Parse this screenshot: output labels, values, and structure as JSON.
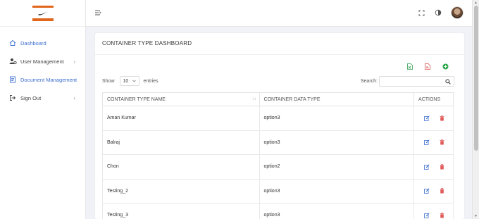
{
  "sidebar": {
    "items": [
      {
        "label": "Dashboard",
        "icon": "home-icon"
      },
      {
        "label": "User Management",
        "icon": "users-gear-icon"
      },
      {
        "label": "Document Management",
        "icon": "document-icon"
      },
      {
        "label": "Sign Out",
        "icon": "sign-out-icon"
      }
    ],
    "chevron": "›"
  },
  "page": {
    "title": "CONTAINER TYPE DASHBOARD"
  },
  "controls": {
    "show_label": "Show",
    "entries_value": "10",
    "entries_label": "entries",
    "search_label": "Search:",
    "search_value": ""
  },
  "table": {
    "headers": [
      "CONTAINER TYPE NAME",
      "CONTAINER DATA TYPE",
      "ACTIONS"
    ],
    "sort_indicator": "↑↓",
    "rows": [
      {
        "name": "Aman Kumar",
        "type": "option3"
      },
      {
        "name": "Balraj",
        "type": "option3"
      },
      {
        "name": "Chon",
        "type": "option2"
      },
      {
        "name": "Testing_2",
        "type": "option3"
      },
      {
        "name": "Testing_3",
        "type": "option3"
      }
    ]
  },
  "colors": {
    "accent": "#3d6fd1",
    "excel_green": "#2e9e4f",
    "pdf_red": "#d9534f",
    "add_green": "#28a745",
    "delete_red": "#e05a5a",
    "logo_orange": "#e2651c"
  }
}
